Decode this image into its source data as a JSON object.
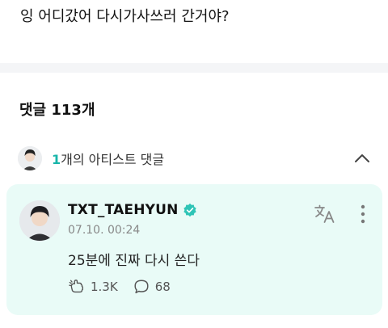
{
  "post": {
    "text": "잉 어디갔어 다시가사쓰러 간거야?"
  },
  "comments": {
    "title": "댓글 113개"
  },
  "artist_comments": {
    "count": "1",
    "label": "개의 아티스트 댓글"
  },
  "comment": {
    "author": "TXT_TAEHYUN",
    "date": "07.10. 00:24",
    "text": "25분에 진짜 다시 쓴다",
    "cheers": "1.3K",
    "replies": "68"
  },
  "colors": {
    "accent": "#18b5a9",
    "card_bg": "#e9fbf7",
    "verified": "#2ec4b6"
  },
  "icons": [
    "chevron-up-icon",
    "verified-badge-icon",
    "translate-icon",
    "more-vertical-icon",
    "cheer-icon",
    "reply-bubble-icon"
  ]
}
